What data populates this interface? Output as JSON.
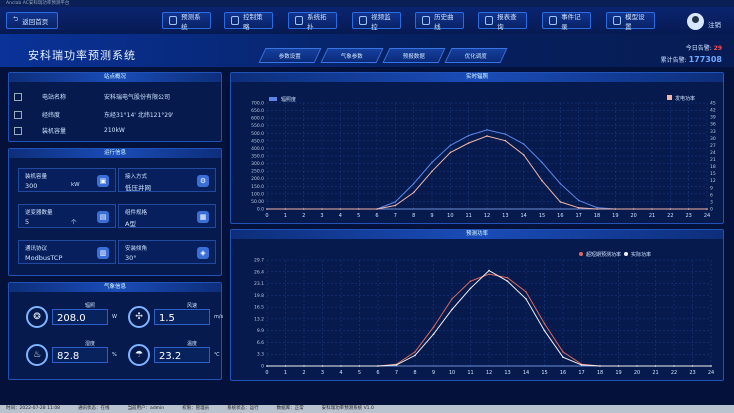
{
  "window_title": "Anclab AC安科瑞功率预测平台",
  "topbar": {
    "back_label": "返回首页",
    "buttons": [
      "预测系统",
      "控制策略",
      "系统拓扑",
      "视频监控",
      "历史曲线",
      "报表查询",
      "事件记录",
      "模型设置"
    ],
    "user_label": "注销"
  },
  "system_title": "安科瑞功率预测系统",
  "tabs": [
    "参数设置",
    "气象参数",
    "预报数据",
    "优化调度"
  ],
  "counters": {
    "today_label": "今日告警:",
    "today_value": "29",
    "total_label": "累计告警:",
    "total_value": "177308"
  },
  "overview": {
    "title": "站点概况",
    "rows": [
      {
        "k": "电站名称",
        "v": "安科瑞电气股份有限公司"
      },
      {
        "k": "经纬度",
        "v": "东经31°14'   北纬121°29'"
      },
      {
        "k": "装机容量",
        "v": "210kW"
      }
    ]
  },
  "operation": {
    "title": "运行信息",
    "cards": [
      {
        "t": "装机容量",
        "v": "300",
        "u": "kW",
        "i": "▣"
      },
      {
        "t": "接入方式",
        "v": "低压并网",
        "u": "",
        "i": "⚙"
      },
      {
        "t": "逆变器数量",
        "v": "5",
        "u": "个",
        "i": "▤"
      },
      {
        "t": "组件规格",
        "v": "A型",
        "u": "",
        "i": "▦"
      },
      {
        "t": "通讯协议",
        "v": "ModbusTCP",
        "u": "",
        "i": "▥"
      },
      {
        "t": "安装倾角",
        "v": "30°",
        "u": "",
        "i": "◈"
      }
    ]
  },
  "weather": {
    "title": "气象信息",
    "items": [
      {
        "label": "辐照",
        "value": "208.0",
        "unit": "W",
        "icon": "❂"
      },
      {
        "label": "风速",
        "value": "1.5",
        "unit": "m/s",
        "icon": "✣"
      },
      {
        "label": "湿度",
        "value": "82.8",
        "unit": "%",
        "icon": "♨"
      },
      {
        "label": "温度",
        "value": "23.2",
        "unit": "℃",
        "icon": "☂"
      }
    ]
  },
  "colors": {
    "accent": "#2c6be0",
    "series_blue": "#5b86e8",
    "series_pink": "#f3b7a6",
    "series_red": "#e06a5a",
    "series_white": "#f2f2f2"
  },
  "chart_data": [
    {
      "type": "line",
      "title": "实时辐照",
      "x": [
        0,
        1,
        2,
        3,
        4,
        5,
        6,
        7,
        8,
        9,
        10,
        11,
        12,
        13,
        14,
        15,
        16,
        17,
        18,
        19,
        20,
        21,
        22,
        23,
        24
      ],
      "ylim": [
        0,
        750
      ],
      "y2lim": [
        0,
        45
      ],
      "left_ticks": [
        "0.0",
        "50.00",
        "100.0",
        "150.0",
        "200.0",
        "250.0",
        "300.0",
        "350.0",
        "400.0",
        "450.0",
        "500.0",
        "550.0",
        "600.0",
        "650.0",
        "700.0"
      ],
      "right_ticks": [
        "0",
        "3",
        "6",
        "9",
        "12",
        "15",
        "18",
        "21",
        "24",
        "27",
        "30",
        "33",
        "36",
        "39",
        "42",
        "45"
      ],
      "series": [
        {
          "name": "辐照度",
          "color": "#5b86e8",
          "values": [
            0,
            0,
            0,
            0,
            0,
            0,
            0,
            50,
            180,
            330,
            450,
            520,
            560,
            530,
            460,
            330,
            180,
            60,
            10,
            0,
            0,
            0,
            0,
            0,
            0
          ]
        },
        {
          "name": "发电功率",
          "color": "#f3b7a6",
          "values": [
            0,
            0,
            0,
            0,
            0,
            0,
            0,
            1.5,
            7,
            16,
            24,
            28,
            31,
            29,
            23,
            12,
            3,
            0.5,
            0,
            0,
            0,
            0,
            0,
            0,
            0
          ]
        }
      ]
    },
    {
      "type": "line",
      "title": "预测功率",
      "x": [
        0,
        1,
        2,
        3,
        4,
        5,
        6,
        7,
        8,
        9,
        10,
        11,
        12,
        13,
        14,
        15,
        16,
        17,
        18,
        19,
        20,
        21,
        22,
        23,
        24
      ],
      "ylim": [
        0,
        30
      ],
      "left_ticks": [
        "0",
        "3.3",
        "6.6",
        "9.9",
        "13.2",
        "16.5",
        "19.8",
        "23.1",
        "26.4",
        "29.7"
      ],
      "series": [
        {
          "name": "超短期预测功率",
          "color": "#e06a5a",
          "values": [
            0,
            0,
            0,
            0,
            0,
            0,
            0,
            0.5,
            4,
            11,
            19,
            24,
            26,
            25,
            21,
            12,
            4,
            0.5,
            0,
            0,
            0,
            0,
            0,
            0,
            0
          ]
        },
        {
          "name": "实际功率",
          "color": "#f2f2f2",
          "values": [
            0,
            0,
            0,
            0,
            0,
            0,
            0,
            0.3,
            3,
            9,
            16,
            22,
            27,
            24,
            19,
            10,
            2.5,
            0.3,
            0,
            0,
            0,
            0,
            0,
            0,
            0
          ]
        }
      ]
    }
  ],
  "statusbar": [
    "时间：2022-07-28 11:08",
    "通讯状态：在线",
    "当前用户：admin",
    "权限：管理员",
    "系统状态：运行",
    "数据库：正常",
    "安科瑞功率预测系统 V1.0"
  ]
}
